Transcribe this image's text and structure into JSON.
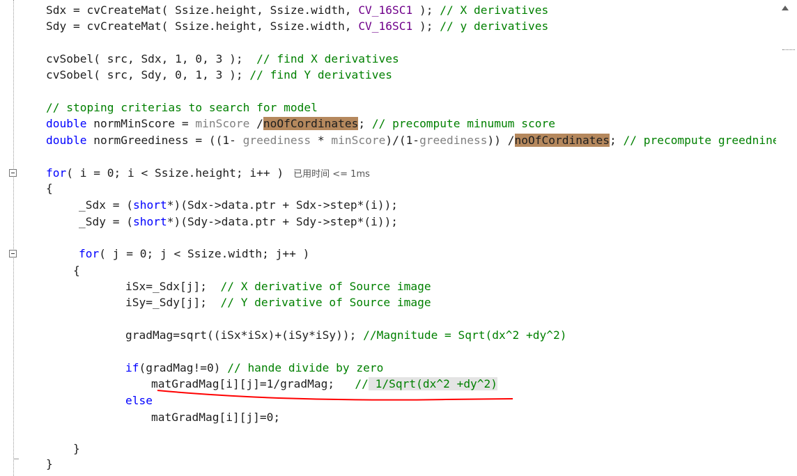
{
  "editor": {
    "lines": [
      {
        "segs": [
          {
            "t": "Sdx = cvCreateMat( Ssize.height, Ssize.width, "
          },
          {
            "t": "CV_16SC1",
            "c": "mac"
          },
          {
            "t": " ); "
          },
          {
            "t": "// X derivatives",
            "c": "cm"
          }
        ]
      },
      {
        "segs": [
          {
            "t": "Sdy = cvCreateMat( Ssize.height, Ssize.width, "
          },
          {
            "t": "CV_16SC1",
            "c": "mac"
          },
          {
            "t": " ); "
          },
          {
            "t": "// y derivatives",
            "c": "cm"
          }
        ]
      },
      {
        "segs": [
          {
            "t": "cvSobel( src, Sdx, 1, 0, 3 );  "
          },
          {
            "t": "// find X derivatives",
            "c": "cm"
          }
        ]
      },
      {
        "segs": [
          {
            "t": "cvSobel( src, Sdy, 0, 1, 3 ); "
          },
          {
            "t": "// find Y derivatives",
            "c": "cm"
          }
        ]
      },
      {
        "segs": [
          {
            "t": "// stoping criterias to search for model",
            "c": "cm"
          }
        ]
      },
      {
        "segs": [
          {
            "t": "double",
            "c": "kw"
          },
          {
            "t": " normMinScore = "
          },
          {
            "t": "minScore",
            "c": "gray"
          },
          {
            "t": " /"
          },
          {
            "t": "noOfCordinates",
            "c": "hl-find"
          },
          {
            "t": "; "
          },
          {
            "t": "// precompute minumum score",
            "c": "cm"
          }
        ]
      },
      {
        "segs": [
          {
            "t": "double",
            "c": "kw"
          },
          {
            "t": " normGreediness = ((1- "
          },
          {
            "t": "greediness",
            "c": "gray"
          },
          {
            "t": " * "
          },
          {
            "t": "minScore",
            "c": "gray"
          },
          {
            "t": ")/(1-"
          },
          {
            "t": "greediness",
            "c": "gray"
          },
          {
            "t": ")) /"
          },
          {
            "t": "noOfCordinates",
            "c": "hl-find"
          },
          {
            "t": "; "
          },
          {
            "t": "// precompute greedniness",
            "c": "cm"
          }
        ]
      },
      {
        "segs": [
          {
            "t": "for",
            "c": "kw"
          },
          {
            "t": "( i = 0; i < Ssize.height; i++ )"
          }
        ],
        "lens": "已用时间 <= 1ms"
      },
      {
        "segs": [
          {
            "t": "{"
          }
        ]
      },
      {
        "segs": [
          {
            "t": "_Sdx = ("
          },
          {
            "t": "short",
            "c": "kw"
          },
          {
            "t": "*)(Sdx->data.ptr + Sdx->step*(i));"
          }
        ]
      },
      {
        "segs": [
          {
            "t": "_Sdy = ("
          },
          {
            "t": "short",
            "c": "kw"
          },
          {
            "t": "*)(Sdy->data.ptr + Sdy->step*(i));"
          }
        ]
      },
      {
        "segs": [
          {
            "t": "for",
            "c": "kw"
          },
          {
            "t": "( j = 0; j < Ssize.width; j++ )"
          }
        ]
      },
      {
        "segs": [
          {
            "t": "{"
          }
        ]
      },
      {
        "segs": [
          {
            "t": "iSx=_Sdx[j];  "
          },
          {
            "t": "// X derivative of Source image",
            "c": "cm"
          }
        ]
      },
      {
        "segs": [
          {
            "t": "iSy=_Sdy[j];  "
          },
          {
            "t": "// Y derivative of Source image",
            "c": "cm"
          }
        ]
      },
      {
        "segs": [
          {
            "t": "gradMag=sqrt((iSx*iSx)+(iSy*iSy)); "
          },
          {
            "t": "//Magnitude = Sqrt(dx^2 +dy^2)",
            "c": "cm"
          }
        ]
      },
      {
        "segs": [
          {
            "t": "if",
            "c": "kw"
          },
          {
            "t": "(gradMag!=0) "
          },
          {
            "t": "// hande divide by zero",
            "c": "cm"
          }
        ]
      },
      {
        "segs": [
          {
            "t": "matGradMag[i][j]=1/gradMag;   "
          },
          {
            "t": "//",
            "c": "cm"
          },
          {
            "t": " 1/Sqrt(dx^2 +dy^2)",
            "c": "cm sel"
          }
        ]
      },
      {
        "segs": [
          {
            "t": "else",
            "c": "kw"
          }
        ]
      },
      {
        "segs": [
          {
            "t": "matGradMag[i][j]=0;"
          }
        ]
      },
      {
        "segs": [
          {
            "t": "}"
          }
        ]
      },
      {
        "segs": [
          {
            "t": "}"
          }
        ]
      }
    ]
  }
}
